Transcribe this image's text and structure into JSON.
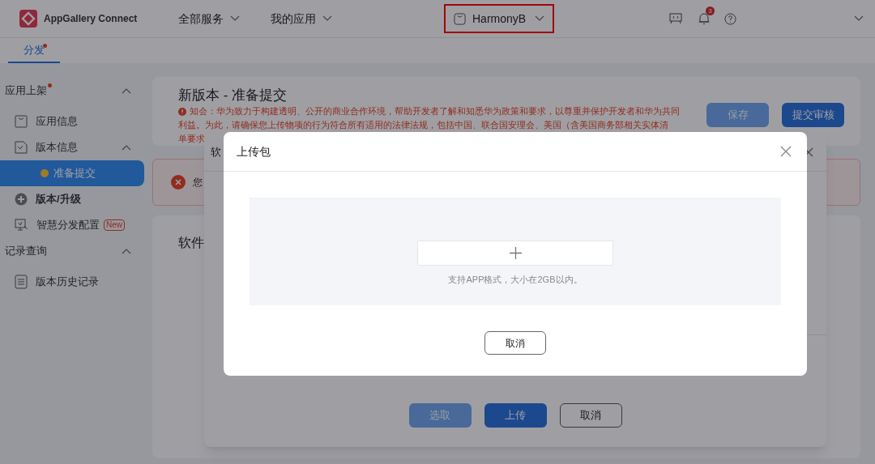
{
  "header": {
    "logo_text": "AppGallery Connect",
    "nav": [
      {
        "label": "全部服务"
      },
      {
        "label": "我的应用"
      }
    ],
    "app_selector": {
      "label": "HarmonyB",
      "highlighted": true
    },
    "notification_badge": "3"
  },
  "tabs": [
    {
      "label": "分发",
      "selected": true,
      "dot": true
    }
  ],
  "sidebar": {
    "groups": [
      {
        "title": "应用上架",
        "dot": true,
        "expanded": true,
        "items": [
          {
            "label": "应用信息",
            "kind": "page"
          },
          {
            "label": "版本信息",
            "kind": "page",
            "expanded": true,
            "children": [
              {
                "label": "准备提交",
                "selected": true
              }
            ]
          },
          {
            "label": "版本/升级",
            "kind": "action"
          },
          {
            "label": "智慧分发配置",
            "kind": "page",
            "badge": "New"
          }
        ]
      },
      {
        "title": "记录查询",
        "expanded": true,
        "items": [
          {
            "label": "版本历史记录",
            "kind": "page"
          }
        ]
      }
    ]
  },
  "content": {
    "title": "新版本 - 准备提交",
    "notice_lines": [
      "知会：华为致力于构建透明、公开的商业合作环境，帮助开发者了解和知悉华为政策和要求，以尊重并保护开发者和华为共同",
      "利益。为此，请确保您上传物项的行为符合所有适用的法律法规，包括中国、联合国安理会、美国（含美国商务部相关实体清",
      "单要求"
    ],
    "buttons": [
      {
        "label": "保存",
        "kind": "secondary",
        "disabled": true
      },
      {
        "label": "提交审核",
        "kind": "primary",
        "disabled": false
      }
    ],
    "alert": {
      "text": "您"
    },
    "card": {
      "title": "软件"
    }
  },
  "back_dialog": {
    "title": "软",
    "buttons": [
      {
        "label": "选取",
        "kind": "primary",
        "disabled": true
      },
      {
        "label": "上传",
        "kind": "primary",
        "disabled": false
      },
      {
        "label": "取消",
        "kind": "secondary",
        "disabled": false
      }
    ]
  },
  "dialog": {
    "title": "上传包",
    "hint": "支持APP格式，大小在2GB以内。",
    "buttons": [
      {
        "label": "取消"
      }
    ]
  }
}
